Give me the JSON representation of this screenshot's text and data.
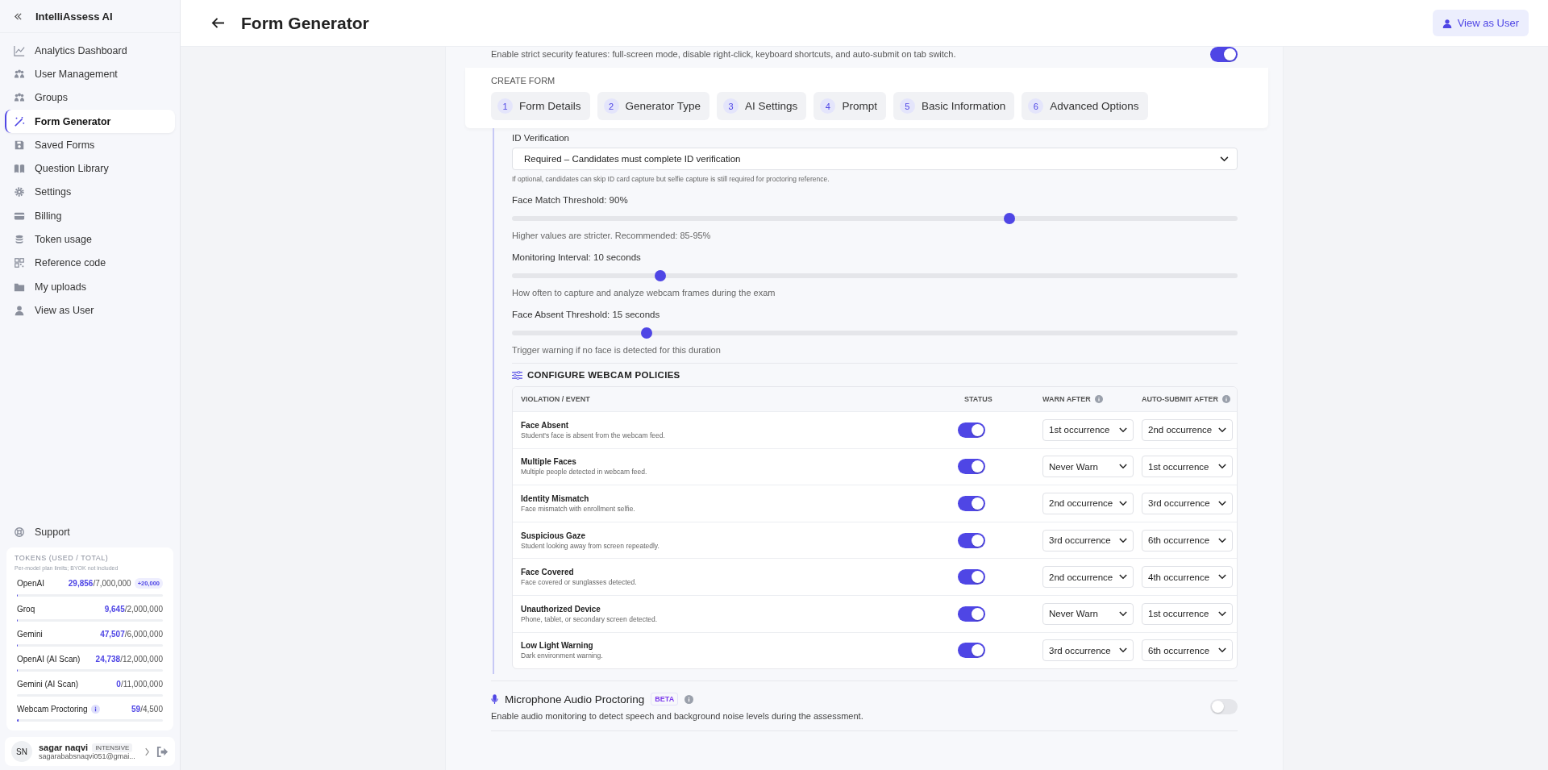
{
  "sidebar": {
    "brand": "IntelliAssess AI",
    "items": [
      {
        "label": "Analytics Dashboard",
        "selected": false
      },
      {
        "label": "User Management",
        "selected": false
      },
      {
        "label": "Groups",
        "selected": false
      },
      {
        "label": "Form Generator",
        "selected": true
      },
      {
        "label": "Saved Forms",
        "selected": false
      },
      {
        "label": "Question Library",
        "selected": false
      },
      {
        "label": "Settings",
        "selected": false
      },
      {
        "label": "Billing",
        "selected": false
      },
      {
        "label": "Token usage",
        "selected": false
      },
      {
        "label": "Reference code",
        "selected": false
      },
      {
        "label": "My uploads",
        "selected": false
      },
      {
        "label": "View as User",
        "selected": false
      }
    ],
    "support": "Support",
    "tokens": {
      "title": "TOKENS (USED / TOTAL)",
      "note": "Per-model plan limits; BYOK not included",
      "rows": [
        {
          "name": "OpenAI",
          "used": "29,856",
          "total": "/7,000,000",
          "badge": "+20,000",
          "info": false,
          "level": 0.004
        },
        {
          "name": "Groq",
          "used": "9,645",
          "total": "/2,000,000",
          "info": false,
          "level": 0.005
        },
        {
          "name": "Gemini",
          "used": "47,507",
          "total": "/6,000,000",
          "info": false,
          "level": 0.008
        },
        {
          "name": "OpenAI (AI Scan)",
          "used": "24,738",
          "total": "/12,000,000",
          "info": false,
          "level": 0.002
        },
        {
          "name": "Gemini (AI Scan)",
          "used": "0",
          "total": "/11,000,000",
          "info": false,
          "level": 0
        },
        {
          "name": "Webcam Proctoring",
          "used": "59",
          "total": "/4,500",
          "info": true,
          "level": 0.013
        }
      ]
    },
    "user": {
      "initials": "SN",
      "name": "sagar naqvi",
      "plan": "INTENSIVE",
      "email": "sagarababsnaqvi051@gmai..."
    }
  },
  "header": {
    "title": "Form Generator",
    "button": "View as User"
  },
  "security": {
    "description": "Enable strict security features: full-screen mode, disable right-click, keyboard shortcuts, and auto-submit on tab switch.",
    "enabled": true
  },
  "steps": {
    "label": "CREATE FORM",
    "items": [
      {
        "number": "1",
        "label": "Form Details"
      },
      {
        "number": "2",
        "label": "Generator Type"
      },
      {
        "number": "3",
        "label": "AI Settings"
      },
      {
        "number": "4",
        "label": "Prompt"
      },
      {
        "number": "5",
        "label": "Basic Information"
      },
      {
        "number": "6",
        "label": "Advanced Options"
      }
    ]
  },
  "id_verification": {
    "label": "ID Verification",
    "value": "Required – Candidates must complete ID verification",
    "help": "If optional, candidates can skip ID card capture but selfie capture is still required for proctoring reference."
  },
  "sliders": [
    {
      "label": "Face Match Threshold: 90%",
      "level": 0.686,
      "help": "Higher values are stricter. Recommended: 85-95%"
    },
    {
      "label": "Monitoring Interval: 10 seconds",
      "level": 0.204,
      "help": "How often to capture and analyze webcam frames during the exam"
    },
    {
      "label": "Face Absent Threshold: 15 seconds",
      "level": 0.186,
      "help": "Trigger warning if no face is detected for this duration"
    }
  ],
  "policies": {
    "title": "CONFIGURE WEBCAM POLICIES",
    "columns": [
      {
        "label": "VIOLATION / EVENT",
        "info": false
      },
      {
        "label": "STATUS",
        "info": false
      },
      {
        "label": "WARN AFTER",
        "info": true
      },
      {
        "label": "AUTO-SUBMIT AFTER",
        "info": true
      }
    ],
    "rows": [
      {
        "name": "Face Absent",
        "description": "Student's face is absent from the webcam feed.",
        "enabled": true,
        "warn_after": "1st occurrence",
        "auto_submit_after": "2nd occurrence"
      },
      {
        "name": "Multiple Faces",
        "description": "Multiple people detected in webcam feed.",
        "enabled": true,
        "warn_after": "Never Warn",
        "auto_submit_after": "1st occurrence"
      },
      {
        "name": "Identity Mismatch",
        "description": "Face mismatch with enrollment selfie.",
        "enabled": true,
        "warn_after": "2nd occurrence",
        "auto_submit_after": "3rd occurrence"
      },
      {
        "name": "Suspicious Gaze",
        "description": "Student looking away from screen repeatedly.",
        "enabled": true,
        "warn_after": "3rd occurrence",
        "auto_submit_after": "6th occurrence"
      },
      {
        "name": "Face Covered",
        "description": "Face covered or sunglasses detected.",
        "enabled": true,
        "warn_after": "2nd occurrence",
        "auto_submit_after": "4th occurrence"
      },
      {
        "name": "Unauthorized Device",
        "description": "Phone, tablet, or secondary screen detected.",
        "enabled": true,
        "warn_after": "Never Warn",
        "auto_submit_after": "1st occurrence"
      },
      {
        "name": "Low Light Warning",
        "description": "Dark environment warning.",
        "enabled": true,
        "warn_after": "3rd occurrence",
        "auto_submit_after": "6th occurrence"
      }
    ]
  },
  "microphone": {
    "title": "Microphone Audio Proctoring",
    "badge": "BETA",
    "description": "Enable audio monitoring to detect speech and background noise levels during the assessment.",
    "enabled": false
  }
}
